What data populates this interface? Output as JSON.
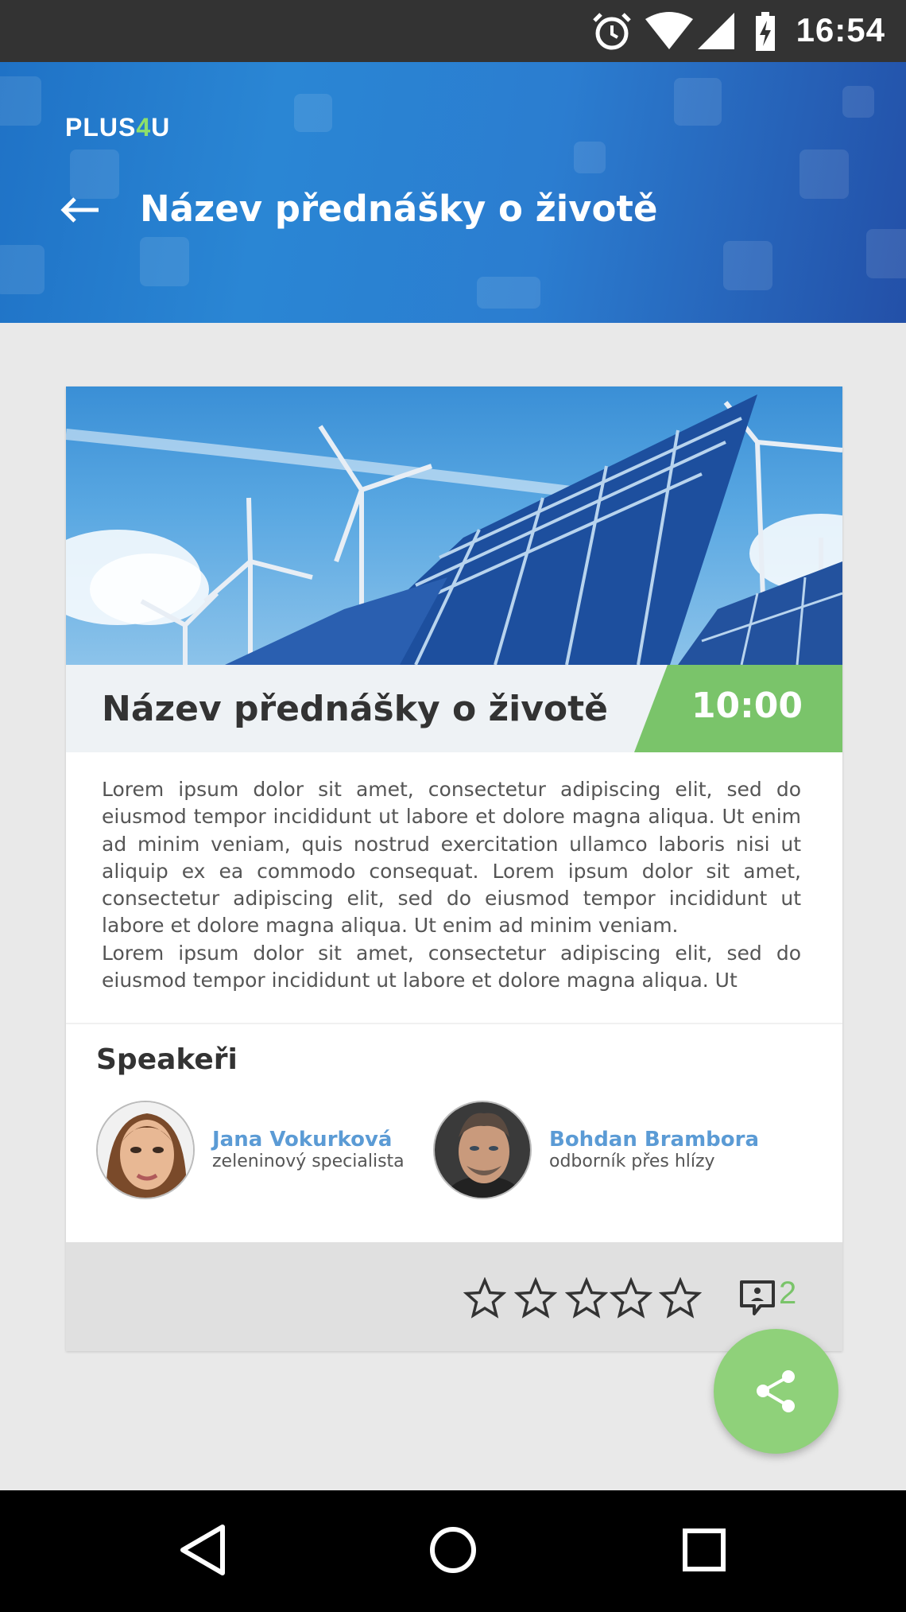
{
  "status_bar": {
    "time": "16:54",
    "icons": [
      "alarm-icon",
      "wifi-icon",
      "signal-icon",
      "battery-charging-icon"
    ]
  },
  "header": {
    "logo": {
      "part1": "PLUS",
      "part2": "4",
      "part3": "U"
    },
    "back_icon": "arrow-left-icon",
    "title": "Název přednášky o životě"
  },
  "lecture": {
    "title": "Název přednášky o životě",
    "time": "10:00",
    "description": [
      "Lorem ipsum dolor sit amet, consectetur adipiscing elit, sed do eiusmod tempor incididunt ut labore et dolore magna aliqua. Ut enim ad minim veniam, quis nostrud exercitation ullamco laboris nisi ut aliquip ex ea commodo consequat. Lorem ipsum dolor sit amet, consectetur adipiscing elit, sed do eiusmod tempor incididunt ut labore et dolore magna aliqua. Ut enim ad minim veniam.",
      "Lorem ipsum dolor sit amet, consectetur adipiscing elit, sed do eiusmod tempor incididunt ut labore et dolore magna aliqua. Ut"
    ]
  },
  "speakers": {
    "heading": "Speakeři",
    "items": [
      {
        "name": "Jana Vokurková",
        "role": "zeleninový specialista"
      },
      {
        "name": "Bohdan Brambora",
        "role": "odborník přes hlízy"
      }
    ]
  },
  "rating": {
    "stars": 5,
    "filled": 0,
    "icon": "star-outline-icon"
  },
  "comments": {
    "count": "2",
    "icon": "comment-icon"
  },
  "fab": {
    "icon": "share-icon"
  },
  "nav_bar": {
    "icons": [
      "back-triangle-icon",
      "home-circle-icon",
      "recents-square-icon"
    ]
  },
  "colors": {
    "accent_green": "#7ac46a",
    "link_blue": "#5b9bd5",
    "header_blue": "#2a86d4"
  }
}
